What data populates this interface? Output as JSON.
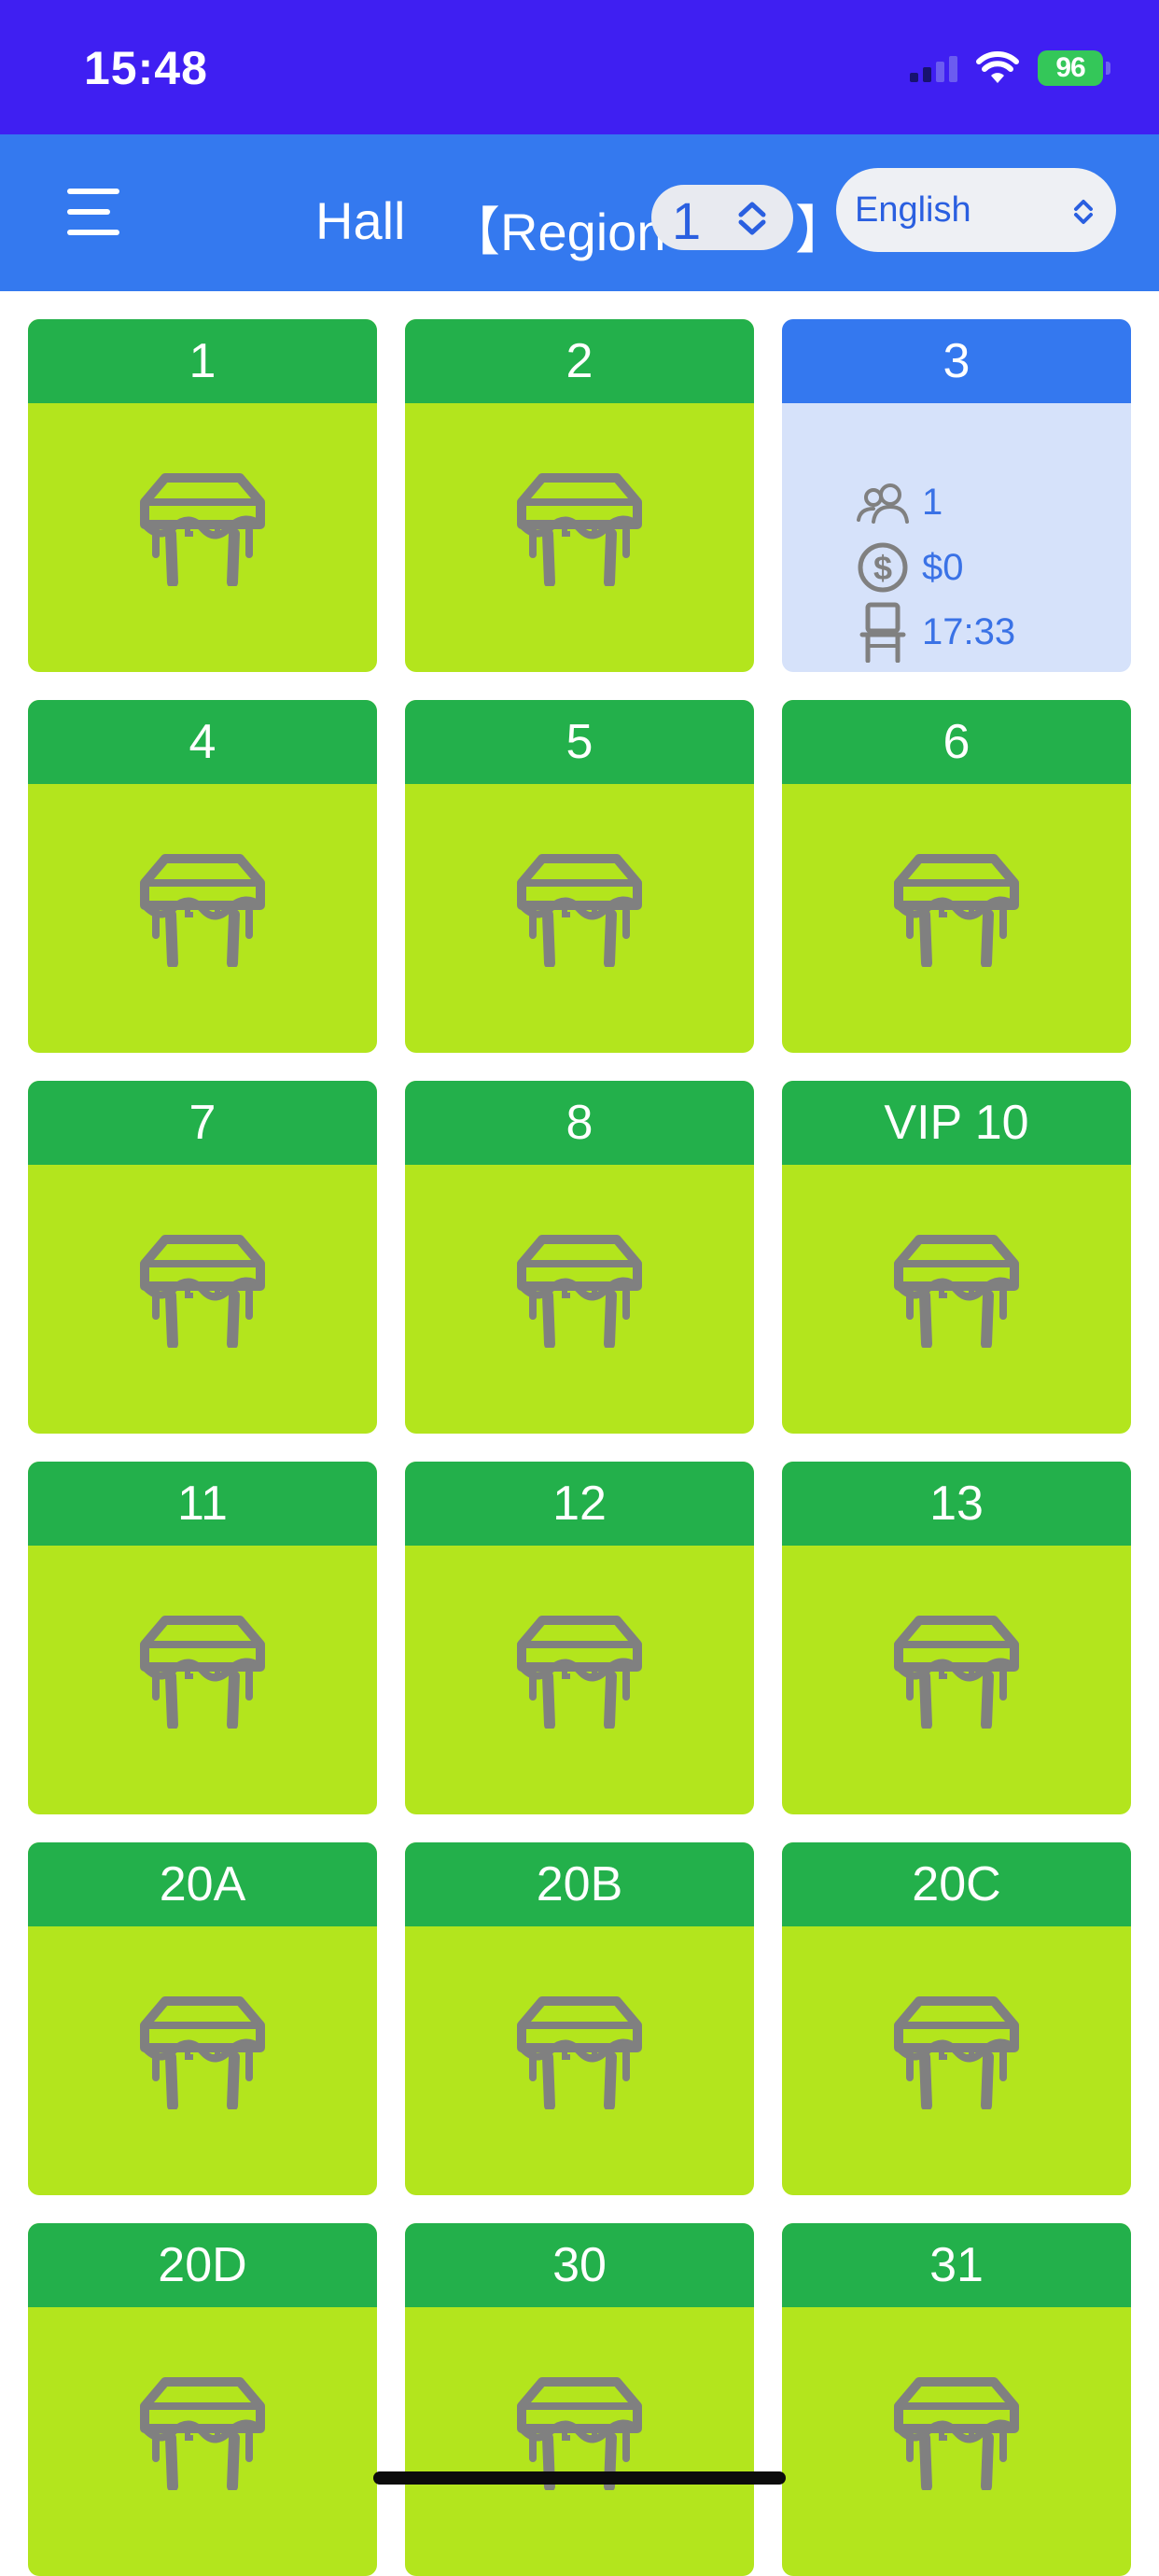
{
  "status_bar": {
    "time": "15:48",
    "battery": "96",
    "background": "#3f1ff2"
  },
  "header": {
    "menu_icon": "hamburger-menu-icon",
    "hall_label": "Hall",
    "region_label": "【Region",
    "region_value": "1",
    "region_close": "】",
    "language_value": "English",
    "background": "#3479ef"
  },
  "colors": {
    "card_header_free": "#23b04b",
    "card_body_free": "#b3e51d",
    "card_header_occupied": "#3478ef",
    "card_body_occupied": "#d6e2fa",
    "info_text": "#3a72e6",
    "icon_gray": "#808080"
  },
  "tables": [
    {
      "name": "1",
      "status": "free",
      "icon": "table-icon"
    },
    {
      "name": "2",
      "status": "free",
      "icon": "table-icon"
    },
    {
      "name": "3",
      "status": "occupied",
      "guests": "1",
      "amount": "$0",
      "time": "17:33"
    },
    {
      "name": "4",
      "status": "free",
      "icon": "table-icon"
    },
    {
      "name": "5",
      "status": "free",
      "icon": "table-icon"
    },
    {
      "name": "6",
      "status": "free",
      "icon": "table-icon"
    },
    {
      "name": "7",
      "status": "free",
      "icon": "table-icon"
    },
    {
      "name": "8",
      "status": "free",
      "icon": "table-icon"
    },
    {
      "name": "VIP 10",
      "status": "free",
      "icon": "table-icon"
    },
    {
      "name": "11",
      "status": "free",
      "icon": "table-icon"
    },
    {
      "name": "12",
      "status": "free",
      "icon": "table-icon"
    },
    {
      "name": "13",
      "status": "free",
      "icon": "table-icon"
    },
    {
      "name": "20A",
      "status": "free",
      "icon": "table-icon"
    },
    {
      "name": "20B",
      "status": "free",
      "icon": "table-icon"
    },
    {
      "name": "20C",
      "status": "free",
      "icon": "table-icon"
    },
    {
      "name": "20D",
      "status": "free",
      "icon": "table-icon"
    },
    {
      "name": "30",
      "status": "free",
      "icon": "table-icon"
    },
    {
      "name": "31",
      "status": "free",
      "icon": "table-icon"
    }
  ]
}
